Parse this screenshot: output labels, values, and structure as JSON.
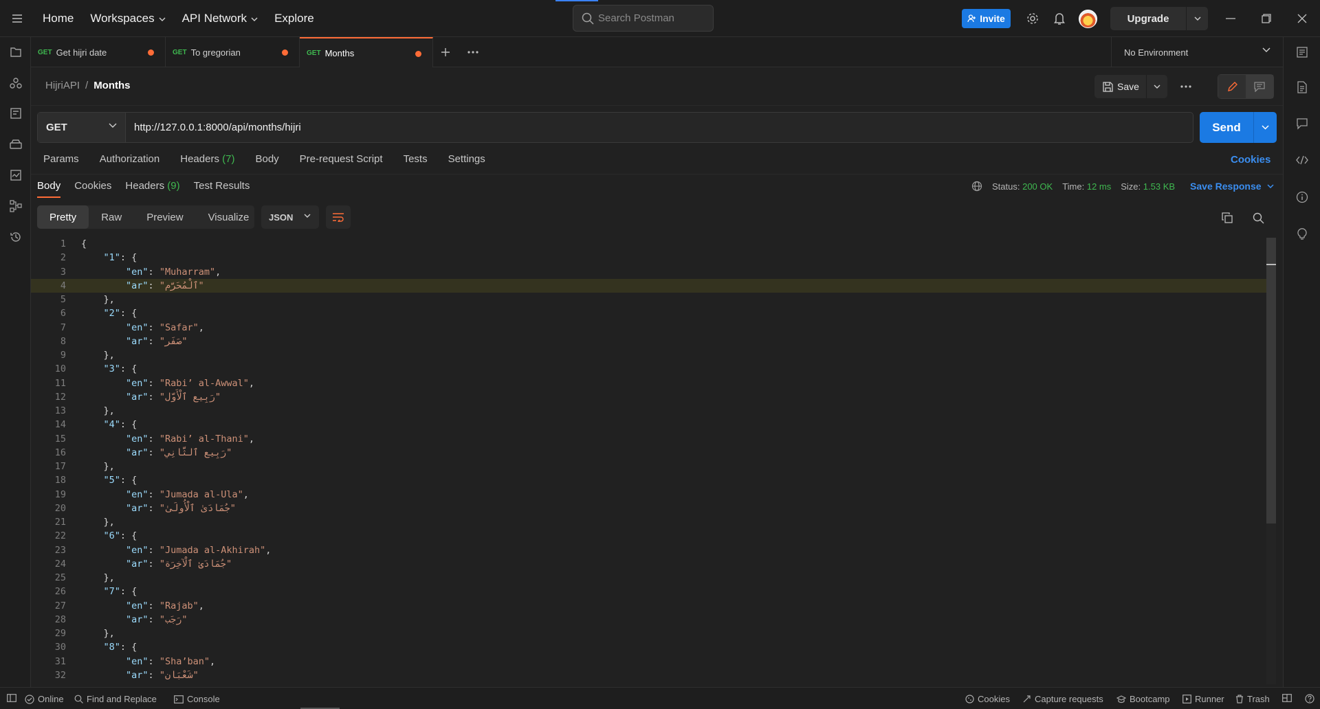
{
  "topnav": {
    "home": "Home",
    "workspaces": "Workspaces",
    "api_network": "API Network",
    "explore": "Explore"
  },
  "search": {
    "placeholder": "Search Postman"
  },
  "topright": {
    "invite": "Invite",
    "upgrade": "Upgrade"
  },
  "tabs": [
    {
      "method": "GET",
      "name": "Get hijri date",
      "unsaved": true
    },
    {
      "method": "GET",
      "name": "To gregorian",
      "unsaved": true
    },
    {
      "method": "GET",
      "name": "Months",
      "unsaved": true,
      "active": true
    }
  ],
  "environment": {
    "selected": "No Environment"
  },
  "breadcrumb": {
    "parent": "HijriAPI",
    "separator": "/",
    "current": "Months"
  },
  "request": {
    "save_label": "Save",
    "method": "GET",
    "url": "http://127.0.0.1:8000/api/months/hijri",
    "send_label": "Send",
    "tabs": {
      "params": "Params",
      "authorization": "Authorization",
      "headers": "Headers",
      "headers_count": "(7)",
      "body": "Body",
      "prerequest": "Pre-request Script",
      "tests": "Tests",
      "settings": "Settings"
    },
    "cookies_link": "Cookies"
  },
  "response": {
    "tabs": {
      "body": "Body",
      "cookies": "Cookies",
      "headers": "Headers",
      "headers_count": "(9)",
      "test_results": "Test Results"
    },
    "status_label": "Status:",
    "status_value": "200 OK",
    "time_label": "Time:",
    "time_value": "12 ms",
    "size_label": "Size:",
    "size_value": "1.53 KB",
    "save_response": "Save Response",
    "format_tabs": [
      "Pretty",
      "Raw",
      "Preview",
      "Visualize"
    ],
    "language": "JSON"
  },
  "code_lines": [
    "{",
    "    \"1\": {",
    "        \"en\": \"Muharram\",",
    "        \"ar\": \"ٱلْمُحَرَّم\"",
    "    },",
    "    \"2\": {",
    "        \"en\": \"Safar\",",
    "        \"ar\": \"صَفَر\"",
    "    },",
    "    \"3\": {",
    "        \"en\": \"Rabi’ al-Awwal\",",
    "        \"ar\": \"رَبِيع ٱلْأَوَّل\"",
    "    },",
    "    \"4\": {",
    "        \"en\": \"Rabi’ al-Thani\",",
    "        \"ar\": \"رَبِيع ٱلثَّانِي\"",
    "    },",
    "    \"5\": {",
    "        \"en\": \"Jumada al-Ula\",",
    "        \"ar\": \"جُمَادَىٰ ٱلْأُولَىٰ\"",
    "    },",
    "    \"6\": {",
    "        \"en\": \"Jumada al-Akhirah\",",
    "        \"ar\": \"جُمَادَىٰ ٱلْآخِرَة\"",
    "    },",
    "    \"7\": {",
    "        \"en\": \"Rajab\",",
    "        \"ar\": \"رَجَب\"",
    "    },",
    "    \"8\": {",
    "        \"en\": \"Sha’ban\",",
    "        \"ar\": \"شَعْبَان\""
  ],
  "footer": {
    "online": "Online",
    "find_replace": "Find and Replace",
    "console": "Console",
    "cookies": "Cookies",
    "capture": "Capture requests",
    "bootcamp": "Bootcamp",
    "runner": "Runner",
    "trash": "Trash"
  },
  "colors": {
    "accent_blue": "#1b7ae3",
    "accent_orange": "#ff6c37",
    "method_green": "#3fb950"
  }
}
